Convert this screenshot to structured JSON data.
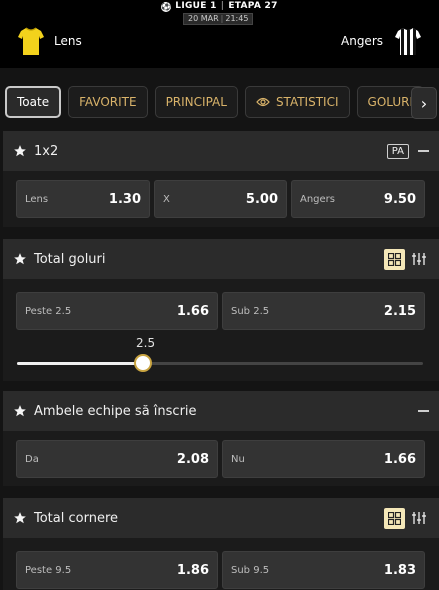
{
  "header": {
    "league": "LIGUE 1",
    "stage": "ETAPA 27",
    "date": "20 MAR",
    "time": "21:45",
    "home_team": "Lens",
    "away_team": "Angers",
    "home_icon": "yellow-jersey-icon",
    "away_icon": "striped-jersey-icon"
  },
  "tabs": [
    {
      "label": "Toate",
      "active": true
    },
    {
      "label": "FAVORITE"
    },
    {
      "label": "PRINCIPAL"
    },
    {
      "label": "STATISTICI",
      "icon": "eye-icon"
    },
    {
      "label": "GOLURI"
    }
  ],
  "colors": {
    "accent_gold": "#d9b36a",
    "header_bg": "#000000",
    "section_bg": "#2b2b2b",
    "odd_bg": "#333333",
    "selected_view_bg": "#f4e7b8"
  },
  "markets": {
    "m1x2": {
      "title": "1x2",
      "badge": "PA",
      "odds": [
        {
          "label": "Lens",
          "value": "1.30"
        },
        {
          "label": "X",
          "value": "5.00"
        },
        {
          "label": "Angers",
          "value": "9.50"
        }
      ]
    },
    "goals": {
      "title": "Total goluri",
      "odds": [
        {
          "label": "Peste 2.5",
          "value": "1.66"
        },
        {
          "label": "Sub 2.5",
          "value": "2.15"
        }
      ],
      "slider_value": "2.5",
      "slider_fraction": 0.31
    },
    "btts": {
      "title": "Ambele echipe să înscrie",
      "odds": [
        {
          "label": "Da",
          "value": "2.08"
        },
        {
          "label": "Nu",
          "value": "1.66"
        }
      ]
    },
    "corners": {
      "title": "Total cornere",
      "odds": [
        {
          "label": "Peste 9.5",
          "value": "1.86"
        },
        {
          "label": "Sub 9.5",
          "value": "1.83"
        }
      ]
    }
  }
}
